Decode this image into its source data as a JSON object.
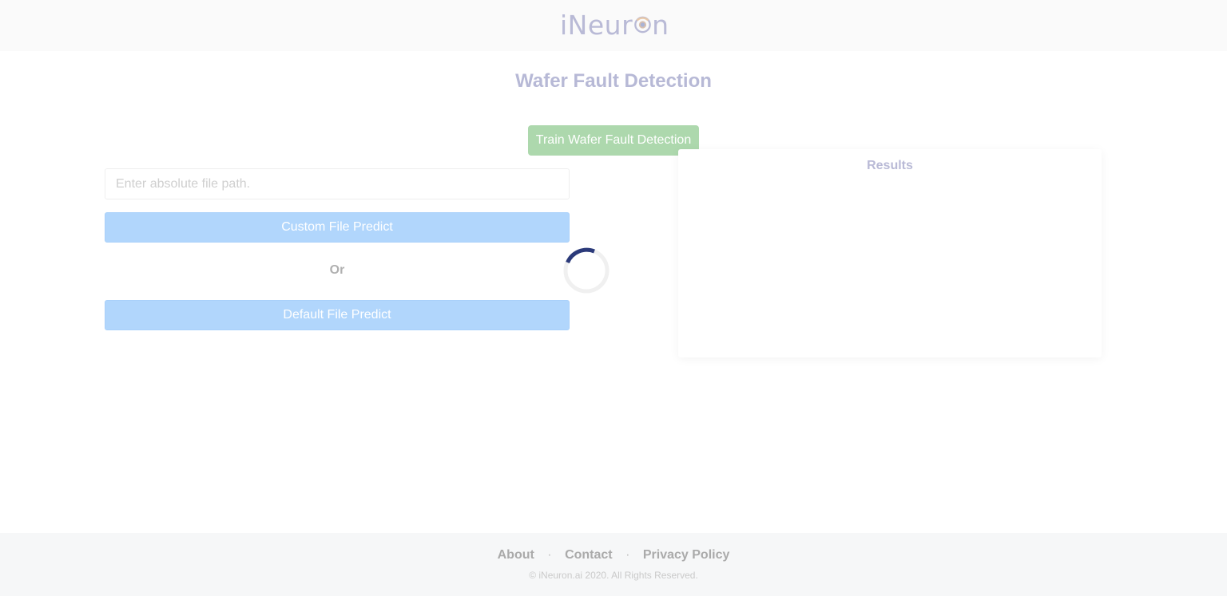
{
  "header": {
    "logo": {
      "prefix": "iNeur",
      "suffix": "n"
    }
  },
  "page": {
    "title": "Wafer Fault Detection"
  },
  "train": {
    "label": "Train Wafer Fault Detection",
    "color": "#add8ad"
  },
  "form": {
    "path_input": {
      "value": "",
      "placeholder": "Enter absolute file path."
    },
    "custom_predict_label": "Custom File Predict",
    "or_label": "Or",
    "default_predict_label": "Default File Predict",
    "button_color": "#b1d6fc"
  },
  "spinner": {
    "icon": "loading-spinner-icon",
    "color": "#2b3a7a"
  },
  "results": {
    "title": "Results"
  },
  "footer": {
    "links": [
      "About",
      "Contact",
      "Privacy Policy"
    ],
    "separator": "·",
    "copyright": "© iNeuron.ai 2020. All Rights Reserved."
  }
}
